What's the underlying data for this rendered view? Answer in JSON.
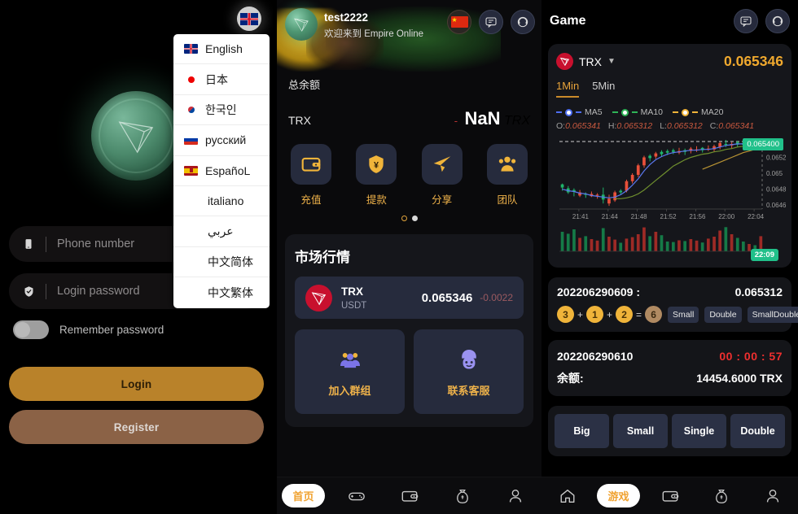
{
  "login": {
    "lang_fab_icon": "uk-flag-icon",
    "languages": [
      {
        "label": "English",
        "flag": "uk"
      },
      {
        "label": "日本",
        "flag": "jp"
      },
      {
        "label": "한국인",
        "flag": "kr"
      },
      {
        "label": "русский",
        "flag": "ru"
      },
      {
        "label": "EspañoL",
        "flag": "es"
      },
      {
        "label": "italiano",
        "flag": ""
      },
      {
        "label": "عربي",
        "flag": ""
      },
      {
        "label": "中文简体",
        "flag": ""
      },
      {
        "label": "中文繁体",
        "flag": ""
      }
    ],
    "phone_placeholder": "Phone number",
    "phone_value": "",
    "password_placeholder": "Login password",
    "password_value": "",
    "remember_label": "Remember password",
    "login_label": "Login",
    "register_label": "Register",
    "accent_primary": "#b9822a",
    "accent_secondary": "#8b6246"
  },
  "home": {
    "user_name": "test2222",
    "user_sub": "欢迎来到 Empire Online",
    "fabs": [
      "cn-flag-icon",
      "chat-icon",
      "support-icon"
    ],
    "balance_title": "总余额",
    "balance_currency": "TRX",
    "balance_amount": "NaN",
    "balance_unit": "TRX",
    "actions": [
      {
        "label": "充值",
        "icon": "wallet-icon"
      },
      {
        "label": "提款",
        "icon": "shield-yen-icon"
      },
      {
        "label": "分享",
        "icon": "paper-plane-icon"
      },
      {
        "label": "团队",
        "icon": "team-icon"
      }
    ],
    "market_title": "市场行情",
    "market_row": {
      "name": "TRX",
      "pair": "USDT",
      "price": "0.065346",
      "change": "-0.0022"
    },
    "tiles": [
      {
        "label": "加入群组",
        "icon": "group-icon"
      },
      {
        "label": "联系客服",
        "icon": "customer-service-icon"
      }
    ],
    "tabs": [
      {
        "label": "首页",
        "icon": "home-icon",
        "active": true
      },
      {
        "label": "",
        "icon": "gamepad-icon",
        "active": false
      },
      {
        "label": "",
        "icon": "wallet-icon",
        "active": false
      },
      {
        "label": "",
        "icon": "money-bag-icon",
        "active": false
      },
      {
        "label": "",
        "icon": "user-icon",
        "active": false
      }
    ]
  },
  "game": {
    "title": "Game",
    "fabs": [
      "chat-icon",
      "support-icon"
    ],
    "symbol": "TRX",
    "symbol_price": "0.065346",
    "timeframes": [
      {
        "label": "1Min",
        "active": true
      },
      {
        "label": "5Min",
        "active": false
      }
    ],
    "ma_legend": [
      {
        "label": "MA5",
        "color": "#4e6ef2"
      },
      {
        "label": "MA10",
        "color": "#2fb457"
      },
      {
        "label": "MA20",
        "color": "#f0b43a"
      }
    ],
    "ohlc": {
      "o_label": "O:",
      "o": "0.065341",
      "h_label": "H:",
      "h": "0.065312",
      "l_label": "L:",
      "l": "0.065312",
      "c_label": "C:",
      "c": "0.065341"
    },
    "price_tag": "0.065400",
    "time_tag": "22:09",
    "result": {
      "draw_id": "202206290609 :",
      "price": "0.065312",
      "numbers": [
        "3",
        "1",
        "2"
      ],
      "sum": "6",
      "tags": [
        "Small",
        "Double",
        "SmallDouble"
      ]
    },
    "next": {
      "draw_id": "202206290610",
      "timer": "00 : 00 : 57",
      "balance_label": "余额:",
      "balance_value": "14454.6000 TRX"
    },
    "bets": [
      "Big",
      "Small",
      "Single",
      "Double"
    ],
    "tabs": [
      {
        "label": "",
        "icon": "home-icon",
        "active": false
      },
      {
        "label": "游戏",
        "icon": "gamepad-icon",
        "active": true
      },
      {
        "label": "",
        "icon": "wallet-icon",
        "active": false
      },
      {
        "label": "",
        "icon": "money-bag-icon",
        "active": false
      },
      {
        "label": "",
        "icon": "user-icon",
        "active": false
      }
    ]
  },
  "chart_data": {
    "type": "candlestick",
    "title": "TRX 1Min",
    "xlabel": "",
    "ylabel": "",
    "ylim": [
      0.06455,
      0.06542
    ],
    "yticks": [
      "0.0652",
      "0.065",
      "0.0648",
      "0.0646"
    ],
    "xticks": [
      "21:41",
      "21:44",
      "21:48",
      "21:52",
      "21:56",
      "22:00",
      "22:04"
    ],
    "current_price_line": 0.0654,
    "current_time": "22:09",
    "up_color": "#1fb36b",
    "down_color": "#e8503a",
    "candles": [
      {
        "o": 0.06482,
        "h": 0.06487,
        "l": 0.06478,
        "c": 0.06486,
        "dir": "up",
        "v": 0.8
      },
      {
        "o": 0.06481,
        "h": 0.06484,
        "l": 0.06474,
        "c": 0.06476,
        "dir": "up",
        "v": 0.72
      },
      {
        "o": 0.06477,
        "h": 0.06481,
        "l": 0.06471,
        "c": 0.06479,
        "dir": "up",
        "v": 0.9
      },
      {
        "o": 0.06476,
        "h": 0.06479,
        "l": 0.0647,
        "c": 0.06472,
        "dir": "down",
        "v": 0.55
      },
      {
        "o": 0.06473,
        "h": 0.06476,
        "l": 0.06469,
        "c": 0.06474,
        "dir": "up",
        "v": 0.62
      },
      {
        "o": 0.06474,
        "h": 0.06477,
        "l": 0.0647,
        "c": 0.06471,
        "dir": "down",
        "v": 0.5
      },
      {
        "o": 0.06472,
        "h": 0.06475,
        "l": 0.06468,
        "c": 0.06473,
        "dir": "down",
        "v": 0.44
      },
      {
        "o": 0.06473,
        "h": 0.06482,
        "l": 0.06462,
        "c": 0.06467,
        "dir": "up",
        "v": 0.95
      },
      {
        "o": 0.06468,
        "h": 0.06473,
        "l": 0.06459,
        "c": 0.06462,
        "dir": "down",
        "v": 0.6
      },
      {
        "o": 0.06466,
        "h": 0.06478,
        "l": 0.06464,
        "c": 0.06476,
        "dir": "down",
        "v": 0.48
      },
      {
        "o": 0.06476,
        "h": 0.0648,
        "l": 0.06473,
        "c": 0.06478,
        "dir": "up",
        "v": 0.35
      },
      {
        "o": 0.06478,
        "h": 0.06492,
        "l": 0.06476,
        "c": 0.0649,
        "dir": "down",
        "v": 0.52
      },
      {
        "o": 0.0649,
        "h": 0.065,
        "l": 0.06487,
        "c": 0.06498,
        "dir": "down",
        "v": 0.58
      },
      {
        "o": 0.06498,
        "h": 0.06512,
        "l": 0.06495,
        "c": 0.0651,
        "dir": "down",
        "v": 0.7
      },
      {
        "o": 0.0651,
        "h": 0.06522,
        "l": 0.06507,
        "c": 0.0652,
        "dir": "down",
        "v": 0.98
      },
      {
        "o": 0.06519,
        "h": 0.06524,
        "l": 0.06515,
        "c": 0.06522,
        "dir": "up",
        "v": 0.62
      },
      {
        "o": 0.06521,
        "h": 0.06527,
        "l": 0.06518,
        "c": 0.06525,
        "dir": "down",
        "v": 0.8
      },
      {
        "o": 0.06524,
        "h": 0.06529,
        "l": 0.06521,
        "c": 0.06527,
        "dir": "up",
        "v": 0.66
      },
      {
        "o": 0.06526,
        "h": 0.0653,
        "l": 0.06523,
        "c": 0.06528,
        "dir": "up",
        "v": 0.4
      },
      {
        "o": 0.06527,
        "h": 0.06531,
        "l": 0.06524,
        "c": 0.06529,
        "dir": "up",
        "v": 0.38
      },
      {
        "o": 0.06528,
        "h": 0.06532,
        "l": 0.06524,
        "c": 0.06526,
        "dir": "down",
        "v": 0.45
      },
      {
        "o": 0.06527,
        "h": 0.06531,
        "l": 0.06523,
        "c": 0.06529,
        "dir": "up",
        "v": 0.42
      },
      {
        "o": 0.06528,
        "h": 0.06533,
        "l": 0.06525,
        "c": 0.06531,
        "dir": "down",
        "v": 0.5
      },
      {
        "o": 0.0653,
        "h": 0.06534,
        "l": 0.06527,
        "c": 0.06529,
        "dir": "down",
        "v": 0.44
      },
      {
        "o": 0.06529,
        "h": 0.06533,
        "l": 0.06526,
        "c": 0.06532,
        "dir": "up",
        "v": 0.36
      },
      {
        "o": 0.06531,
        "h": 0.06535,
        "l": 0.06528,
        "c": 0.0653,
        "dir": "down",
        "v": 0.52
      },
      {
        "o": 0.0653,
        "h": 0.06536,
        "l": 0.06527,
        "c": 0.06534,
        "dir": "down",
        "v": 0.6
      },
      {
        "o": 0.06533,
        "h": 0.0654,
        "l": 0.0653,
        "c": 0.06538,
        "dir": "down",
        "v": 0.85
      },
      {
        "o": 0.06537,
        "h": 0.06542,
        "l": 0.06533,
        "c": 0.06536,
        "dir": "up",
        "v": 0.99
      },
      {
        "o": 0.06535,
        "h": 0.06539,
        "l": 0.06531,
        "c": 0.06537,
        "dir": "down",
        "v": 0.7
      },
      {
        "o": 0.06536,
        "h": 0.06541,
        "l": 0.06533,
        "c": 0.06539,
        "dir": "up",
        "v": 0.55
      },
      {
        "o": 0.06538,
        "h": 0.06542,
        "l": 0.06534,
        "c": 0.06536,
        "dir": "up",
        "v": 0.4
      },
      {
        "o": 0.06536,
        "h": 0.0654,
        "l": 0.06533,
        "c": 0.06538,
        "dir": "down",
        "v": 0.3
      },
      {
        "o": 0.06537,
        "h": 0.06541,
        "l": 0.06534,
        "c": 0.0654,
        "dir": "up",
        "v": 0.25
      },
      {
        "o": 0.06538,
        "h": 0.06544,
        "l": 0.06535,
        "c": 0.06541,
        "dir": "down",
        "v": 0.62
      }
    ],
    "ma5": [
      0.0648,
      0.06478,
      0.06477,
      0.06475,
      0.06474,
      0.06472,
      0.06471,
      0.0647,
      0.06469,
      0.0647,
      0.06473,
      0.06478,
      0.06485,
      0.06493,
      0.06503,
      0.06511,
      0.06517,
      0.06521,
      0.06524,
      0.06526,
      0.06527,
      0.06528,
      0.06529,
      0.06529,
      0.0653,
      0.0653,
      0.06531,
      0.06533,
      0.06535,
      0.06536,
      0.06537,
      0.06537,
      0.06538,
      0.06539,
      0.0654
    ],
    "ma10": [
      null,
      null,
      null,
      null,
      null,
      null,
      null,
      null,
      null,
      0.06468,
      0.06468,
      0.06469,
      0.06471,
      0.06474,
      0.06479,
      0.06485,
      0.06491,
      0.06497,
      0.06503,
      0.06509,
      0.06513,
      0.06517,
      0.0652,
      0.06522,
      0.06524,
      0.06525,
      0.06527,
      0.06528,
      0.0653,
      0.06531,
      0.06533,
      0.06534,
      0.06535,
      0.06536,
      0.06537
    ],
    "ma20": [
      null,
      null,
      null,
      null,
      null,
      null,
      null,
      null,
      null,
      null,
      null,
      null,
      null,
      null,
      null,
      null,
      null,
      null,
      null,
      null,
      null,
      null,
      null,
      null,
      0.06505,
      0.06508,
      0.06511,
      0.06514,
      0.06517,
      0.0652,
      0.06523,
      0.06526,
      0.06528,
      0.0653,
      0.06532
    ]
  }
}
